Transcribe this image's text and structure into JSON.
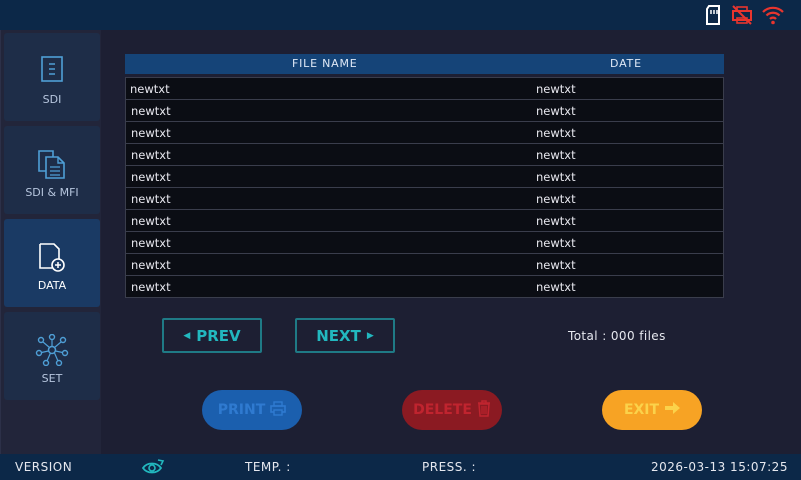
{
  "status_icons": [
    "sd-card-icon",
    "printer-disconnected-icon",
    "wifi-alert-icon"
  ],
  "colors": {
    "accent_teal": "#22b8bf",
    "print": "#1b5fae",
    "delete": "#8b1a22",
    "exit": "#f7a324",
    "bar": "#0c2848"
  },
  "sidebar": {
    "items": [
      {
        "label": "SDI",
        "icon": "document-icon",
        "active": false
      },
      {
        "label": "SDI & MFI",
        "icon": "documents-icon",
        "active": false
      },
      {
        "label": "DATA",
        "icon": "add-file-icon",
        "active": true
      },
      {
        "label": "SET",
        "icon": "network-icon",
        "active": false
      }
    ]
  },
  "table": {
    "headers": [
      "FILE NAME",
      "DATE"
    ],
    "rows": [
      [
        "newtxt",
        "newtxt"
      ],
      [
        "newtxt",
        "newtxt"
      ],
      [
        "newtxt",
        "newtxt"
      ],
      [
        "newtxt",
        "newtxt"
      ],
      [
        "newtxt",
        "newtxt"
      ],
      [
        "newtxt",
        "newtxt"
      ],
      [
        "newtxt",
        "newtxt"
      ],
      [
        "newtxt",
        "newtxt"
      ],
      [
        "newtxt",
        "newtxt"
      ],
      [
        "newtxt",
        "newtxt"
      ]
    ]
  },
  "pagination": {
    "prev_label": "PREV",
    "next_label": "NEXT",
    "total_text": "Total :  000 files"
  },
  "actions": {
    "print_label": "PRINT",
    "delete_label": "DELETE",
    "exit_label": "EXIT"
  },
  "statusbar": {
    "version_label": "VERSION",
    "temp_label": "TEMP. :",
    "press_label": "PRESS. :",
    "datetime": "2026-03-13 15:07:25"
  }
}
